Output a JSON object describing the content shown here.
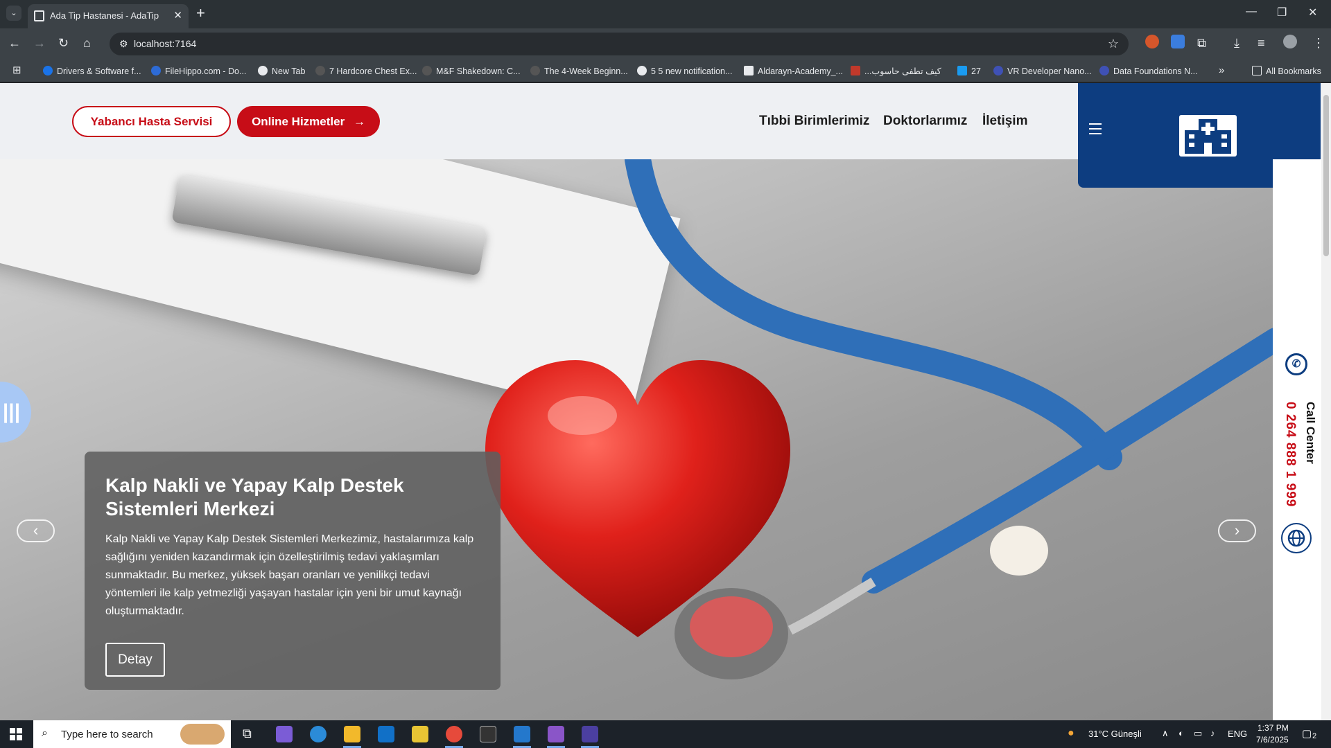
{
  "browser": {
    "tab_title": "Ada Tip Hastanesi - AdaTip",
    "tab_close": "✕",
    "new_tab": "+",
    "url": "localhost:7164",
    "bookmarks": [
      "Drivers & Software f...",
      "FileHippo.com - Do...",
      "New Tab",
      "7 Hardcore Chest Ex...",
      "M&F Shakedown: C...",
      "The 4-Week Beginn...",
      "5 5 new notification...",
      "Aldarayn-Academy_...",
      "...كيف تطفى حاسوب",
      "27",
      "VR Developer Nano...",
      "Data Foundations N..."
    ],
    "more_bookmarks": "»",
    "all_bookmarks": "All Bookmarks"
  },
  "header": {
    "foreign_patient_button": "Yabancı Hasta Servisi",
    "online_services_button": "Online Hizmetler",
    "online_arrow": "→",
    "nav": [
      "Tıbbi Birimlerimiz",
      "Doktorlarımız",
      "İletişim"
    ]
  },
  "side_contact": {
    "call_center_label": "Call Center",
    "phone": "0 264 888 1 999"
  },
  "slider": {
    "prev": "‹",
    "next": "›",
    "side_tab_icon": "|||",
    "title": "Kalp Nakli ve Yapay Kalp Destek Sistemleri Merkezi",
    "text": "Kalp Nakli ve Yapay Kalp Destek Sistemleri Merkezimiz, hastalarımıza kalp sağlığını yeniden kazandırmak için özelleştirilmiş tedavi yaklaşımları sunmaktadır. Bu merkez, yüksek başarı oranları ve yenilikçi tedavi yöntemleri ile kalp yetmezliği yaşayan hastalar için yeni bir umut kaynağı oluşturmaktadır.",
    "button": "Detay"
  },
  "taskbar": {
    "search_placeholder": "Type here to search",
    "weather": "31°C  Güneşli",
    "language": "ENG",
    "time": "1:37 PM",
    "date": "7/6/2025",
    "notification_count": "2"
  },
  "colors": {
    "brand_red": "#c70d17",
    "brand_navy": "#0d3d80"
  }
}
